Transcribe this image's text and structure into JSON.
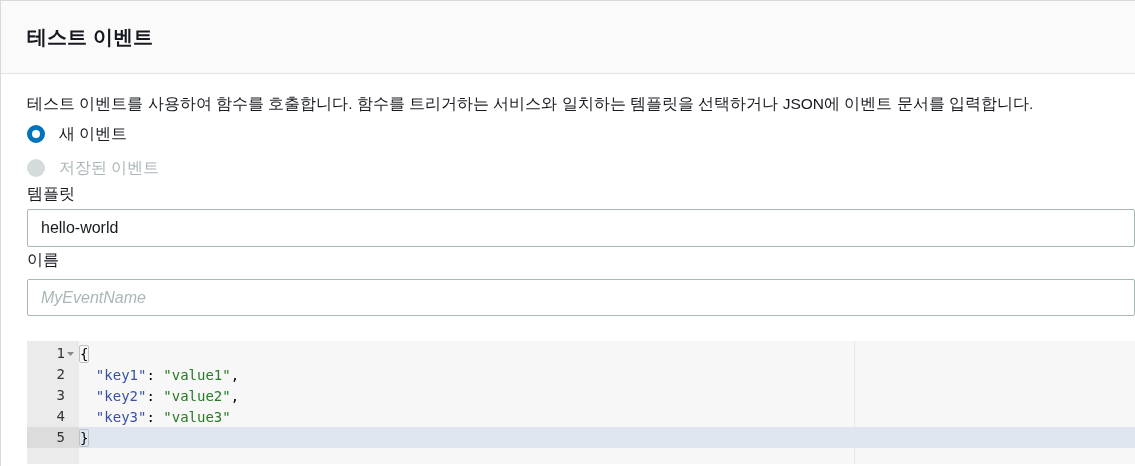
{
  "header": {
    "title": "테스트 이벤트"
  },
  "description": "테스트 이벤트를 사용하여 함수를 호출합니다. 함수를 트리거하는 서비스와 일치하는 템플릿을 선택하거나 JSON에 이벤트 문서를 입력합니다.",
  "event_options": [
    {
      "label": "새 이벤트",
      "selected": true,
      "disabled": false
    },
    {
      "label": "저장된 이벤트",
      "selected": false,
      "disabled": true
    }
  ],
  "template": {
    "label": "템플릿",
    "value": "hello-world"
  },
  "name": {
    "label": "이름",
    "placeholder": "MyEventName"
  },
  "editor": {
    "lines": [
      {
        "number": "1",
        "foldable": true,
        "active": false,
        "tokens": [
          {
            "kind": "bracket",
            "text": "{"
          }
        ]
      },
      {
        "number": "2",
        "foldable": false,
        "active": false,
        "tokens": [
          {
            "kind": "key",
            "text": "  \"key1\""
          },
          {
            "kind": "punct",
            "text": ": "
          },
          {
            "kind": "string",
            "text": "\"value1\""
          },
          {
            "kind": "punct",
            "text": ","
          }
        ]
      },
      {
        "number": "3",
        "foldable": false,
        "active": false,
        "tokens": [
          {
            "kind": "key",
            "text": "  \"key2\""
          },
          {
            "kind": "punct",
            "text": ": "
          },
          {
            "kind": "string",
            "text": "\"value2\""
          },
          {
            "kind": "punct",
            "text": ","
          }
        ]
      },
      {
        "number": "4",
        "foldable": false,
        "active": false,
        "tokens": [
          {
            "kind": "key",
            "text": "  \"key3\""
          },
          {
            "kind": "punct",
            "text": ": "
          },
          {
            "kind": "string",
            "text": "\"value3\""
          }
        ]
      },
      {
        "number": "5",
        "foldable": false,
        "active": true,
        "tokens": [
          {
            "kind": "bracket",
            "text": "}"
          }
        ]
      }
    ]
  }
}
